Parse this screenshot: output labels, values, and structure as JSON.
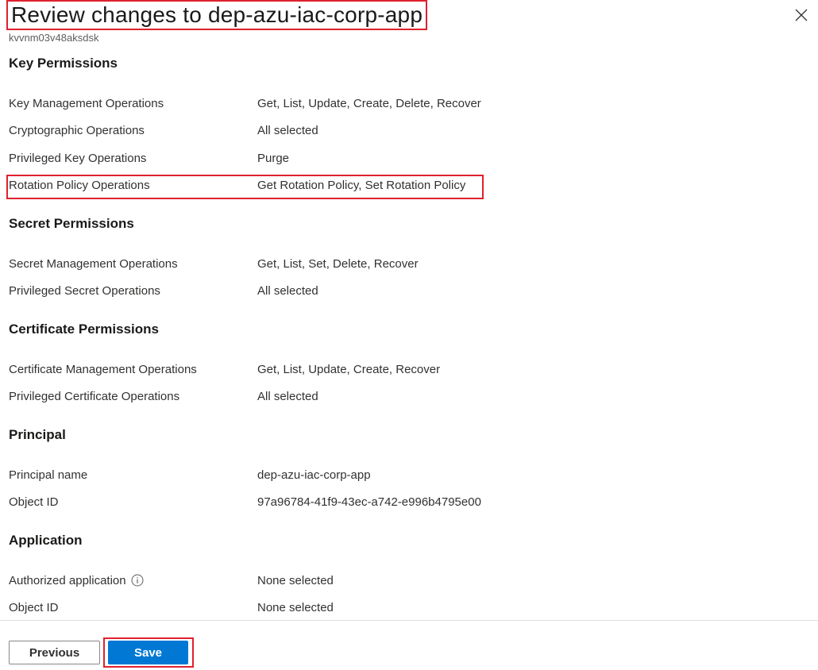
{
  "header": {
    "title": "Review changes to dep-azu-iac-corp-app",
    "subtitle": "kvvnm03v48aksdsk",
    "close_icon": "close-icon"
  },
  "sections": {
    "key_permissions": {
      "heading": "Key Permissions",
      "rows": [
        {
          "label": "Key Management Operations",
          "value": "Get, List, Update, Create, Delete, Recover"
        },
        {
          "label": "Cryptographic Operations",
          "value": "All selected"
        },
        {
          "label": "Privileged Key Operations",
          "value": "Purge"
        },
        {
          "label": "Rotation Policy Operations",
          "value": "Get Rotation Policy, Set Rotation Policy"
        }
      ]
    },
    "secret_permissions": {
      "heading": "Secret Permissions",
      "rows": [
        {
          "label": "Secret Management Operations",
          "value": "Get, List, Set, Delete, Recover"
        },
        {
          "label": "Privileged Secret Operations",
          "value": "All selected"
        }
      ]
    },
    "certificate_permissions": {
      "heading": "Certificate Permissions",
      "rows": [
        {
          "label": "Certificate Management Operations",
          "value": "Get, List, Update, Create, Recover"
        },
        {
          "label": "Privileged Certificate Operations",
          "value": "All selected"
        }
      ]
    },
    "principal": {
      "heading": "Principal",
      "rows": [
        {
          "label": "Principal name",
          "value": "dep-azu-iac-corp-app"
        },
        {
          "label": "Object ID",
          "value": "97a96784-41f9-43ec-a742-e996b4795e00"
        }
      ]
    },
    "application": {
      "heading": "Application",
      "rows": [
        {
          "label": "Authorized application",
          "value": "None selected",
          "icon": "info-icon"
        },
        {
          "label": "Object ID",
          "value": "None selected"
        }
      ]
    }
  },
  "footer": {
    "previous_label": "Previous",
    "save_label": "Save"
  },
  "colors": {
    "primary": "#0078d4",
    "highlight": "#e0202e",
    "text": "#323130"
  }
}
